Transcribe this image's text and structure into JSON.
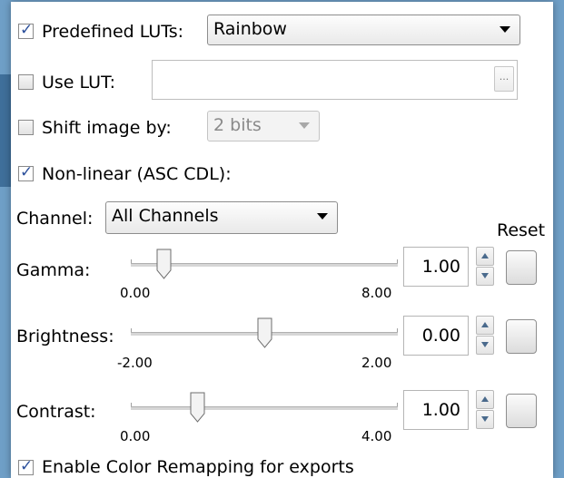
{
  "predefined_luts": {
    "checked": true,
    "label": "Predefined LUTs:",
    "selected": "Rainbow"
  },
  "use_lut": {
    "checked": false,
    "label": "Use LUT:",
    "path": "",
    "browse_label": "..."
  },
  "shift_image": {
    "checked": false,
    "label": "Shift image by:",
    "selected": "2 bits"
  },
  "nonlinear": {
    "checked": true,
    "label": "Non-linear (ASC CDL):"
  },
  "channel": {
    "label": "Channel:",
    "selected": "All Channels"
  },
  "reset_header": "Reset",
  "gamma": {
    "label": "Gamma:",
    "min": "0.00",
    "max": "8.00",
    "value": "1.00",
    "slider_fraction": 0.125
  },
  "brightness": {
    "label": "Brightness:",
    "min": "-2.00",
    "max": "2.00",
    "value": "0.00",
    "slider_fraction": 0.5
  },
  "contrast": {
    "label": "Contrast:",
    "min": "0.00",
    "max": "4.00",
    "value": "1.00",
    "slider_fraction": 0.25
  },
  "enable_remap": {
    "checked": true,
    "label": "Enable Color Remapping for exports"
  }
}
